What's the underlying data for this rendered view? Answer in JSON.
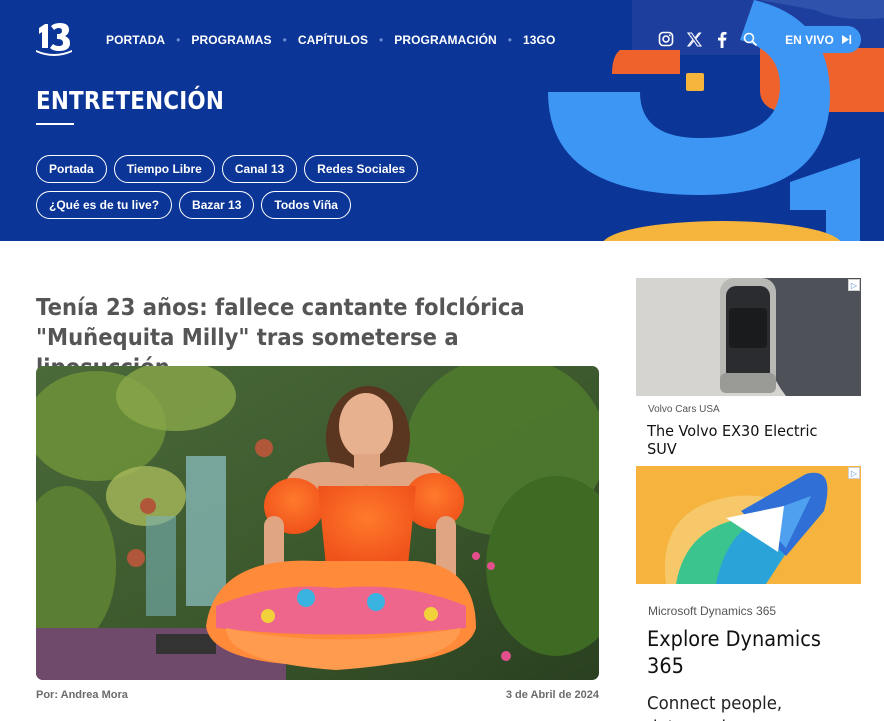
{
  "header": {
    "logo_text": "13",
    "nav": [
      {
        "label": "PORTADA"
      },
      {
        "label": "PROGRAMAS"
      },
      {
        "label": "CAPÍTULOS"
      },
      {
        "label": "PROGRAMACIÓN"
      },
      {
        "label": "13GO"
      }
    ],
    "icons": [
      "instagram-icon",
      "x-twitter-icon",
      "facebook-icon",
      "search-icon"
    ],
    "live_button": "EN VIVO",
    "section_title": "ENTRETENCIÓN",
    "pills_row1": [
      "Portada",
      "Tiempo Libre",
      "Canal 13",
      "Redes Sociales"
    ],
    "pills_row2": [
      "¿Qué es de tu live?",
      "Bazar 13",
      "Todos Viña"
    ],
    "colors": {
      "background": "#0b3596",
      "accent_blue": "#3d96f4",
      "accent_orange": "#f0622c",
      "accent_yellow": "#f5b43c"
    }
  },
  "article": {
    "headline": "Tenía 23 años: fallece cantante folclórica \"Muñequita Milly\" tras someterse a liposucción",
    "author": "Por: Andrea Mora",
    "date": "3 de Abril de 2024"
  },
  "ads": {
    "ad1": {
      "sponsor": "Volvo Cars USA",
      "title": "The Volvo EX30 Electric SUV"
    },
    "ad2": {
      "sponsor": "Microsoft Dynamics 365",
      "title": "Explore Dynamics 365",
      "body": "Connect people, data, and processes"
    }
  }
}
